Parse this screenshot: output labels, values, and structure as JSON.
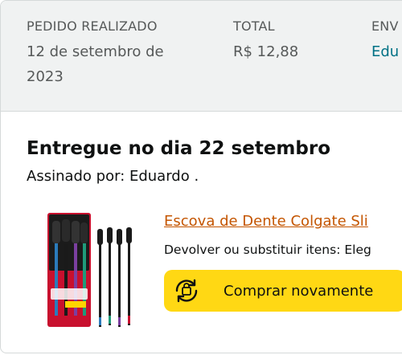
{
  "order_header": {
    "placed_label": "PEDIDO REALIZADO",
    "placed_value_line1": "12 de setembro de",
    "placed_value_line2": "2023",
    "total_label": "TOTAL",
    "total_value": "R$ 12,88",
    "ship_label": "ENV",
    "ship_value": "Edu"
  },
  "shipment": {
    "delivery_title": "Entregue no dia 22 setembro",
    "signed_by": "Assinado por: Eduardo ."
  },
  "item": {
    "title": "Escova de Dente Colgate Sli",
    "return_text": "Devolver ou substituir itens: Eleg",
    "image_icon": "toothbrush-pack-image"
  },
  "actions": {
    "buy_again_label": "Comprar novamente",
    "buy_again_icon": "buy-again-cycle-icon"
  },
  "colors": {
    "header_bg": "#f0f2f2",
    "link_teal": "#007185",
    "product_link": "#c45500",
    "button_yellow": "#ffd814"
  }
}
